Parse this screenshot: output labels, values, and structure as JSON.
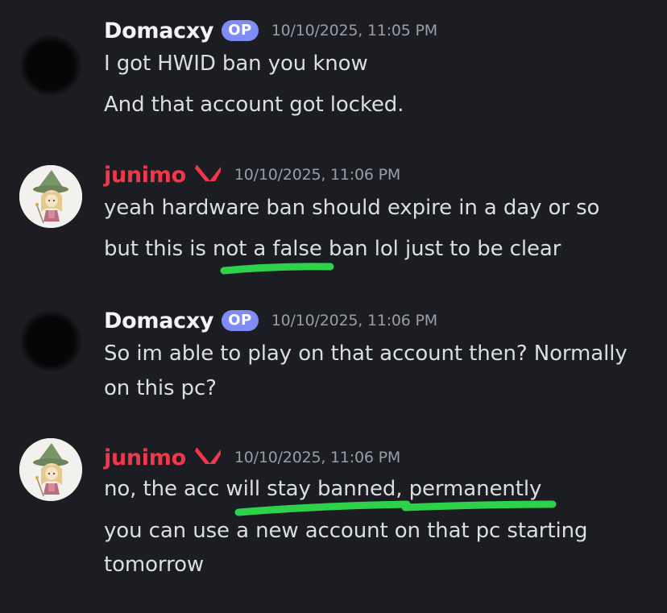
{
  "messages": [
    {
      "author": "Domacxy",
      "badge": "OP",
      "timestamp": "10/10/2025, 11:05 PM",
      "lines": [
        "I got HWID ban you know",
        "And that account got locked."
      ]
    },
    {
      "author": "junimo",
      "timestamp": "10/10/2025, 11:06 PM",
      "lines": [
        "yeah hardware ban should expire in a day or so",
        "but this is not a false ban lol just to be clear"
      ]
    },
    {
      "author": "Domacxy",
      "badge": "OP",
      "timestamp": "10/10/2025, 11:06 PM",
      "lines": [
        "So im able to play on that account then? Normally",
        "on this pc?"
      ]
    },
    {
      "author": "junimo",
      "timestamp": "10/10/2025, 11:06 PM",
      "lines": [
        "no, the acc will stay banned, permanently",
        "you can use a new account on that pc starting",
        "tomorrow"
      ]
    }
  ],
  "icons": {
    "role_icon": "valorant-icon",
    "avatar_op": "dark-avatar",
    "avatar_junimo": "witch-character-avatar"
  },
  "colors": {
    "background": "#1c1d22",
    "username_op": "#f2f3f5",
    "username_junimo": "#f2374b",
    "op_badge": "#7f8cf7",
    "timestamp": "#9a9ca6",
    "message_text": "#dbdee1",
    "highlight_marker": "#2ed14a"
  }
}
